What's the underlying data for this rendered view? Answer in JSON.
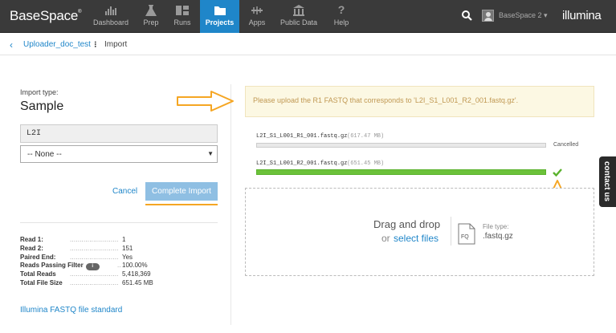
{
  "nav": {
    "brand": "BaseSpace",
    "brand_mark": "®",
    "items": [
      {
        "label": "Dashboard",
        "icon": "dashboard-icon"
      },
      {
        "label": "Prep",
        "icon": "flask-icon"
      },
      {
        "label": "Runs",
        "icon": "runs-icon"
      },
      {
        "label": "Projects",
        "icon": "folder-icon",
        "active": true
      },
      {
        "label": "Apps",
        "icon": "apps-icon"
      },
      {
        "label": "Public Data",
        "icon": "bank-icon"
      },
      {
        "label": "Help",
        "icon": "help-icon"
      }
    ],
    "user": "BaseSpace 2 ▾",
    "company": "illumina"
  },
  "breadcrumb": {
    "back_icon": "‹",
    "project": "Uploader_doc_test",
    "separator": "⁝",
    "current": "Import"
  },
  "left": {
    "import_type_label": "Import type:",
    "import_type_value": "Sample",
    "sample_name": "L2I",
    "select_value": "-- None --",
    "cancel_label": "Cancel",
    "complete_label": "Complete Import",
    "stats": [
      {
        "key": "Read 1:",
        "value": "1"
      },
      {
        "key": "Read 2:",
        "value": "151"
      },
      {
        "key": "Paired End:",
        "value": "Yes"
      },
      {
        "key": "Reads Passing Filter",
        "value": "100.00%",
        "info": true
      },
      {
        "key": "Total Reads",
        "value": "5,418,369"
      },
      {
        "key": "Total File Size",
        "value": "651.45 MB"
      }
    ],
    "info_badge": "i",
    "standard_link": "Illumina FASTQ file standard"
  },
  "right": {
    "alert": "Please upload the R1 FASTQ that corresponds to 'L2I_S1_L001_R2_001.fastq.gz'.",
    "files": [
      {
        "name": "L2I_S1_L001_R1_001.fastq.gz",
        "size": "(617.47 MB)",
        "progress": 0.0,
        "status": "Cancelled"
      },
      {
        "name": "L2I_S1_L001_R2_001.fastq.gz",
        "size": "(651.45 MB)",
        "progress": 1.0,
        "status": ""
      }
    ],
    "dropzone": {
      "title": "Drag and drop",
      "or": "or",
      "select": "select files",
      "file_type_label": "File type:",
      "file_type_value": ".fastq.gz",
      "fq_icon_text": "FQ"
    }
  },
  "contact_tab": "contact us",
  "colors": {
    "accent": "#1f86c9",
    "nav_bg": "#3a3a3a",
    "annotation": "#f5a623",
    "success": "#6cc23a"
  }
}
